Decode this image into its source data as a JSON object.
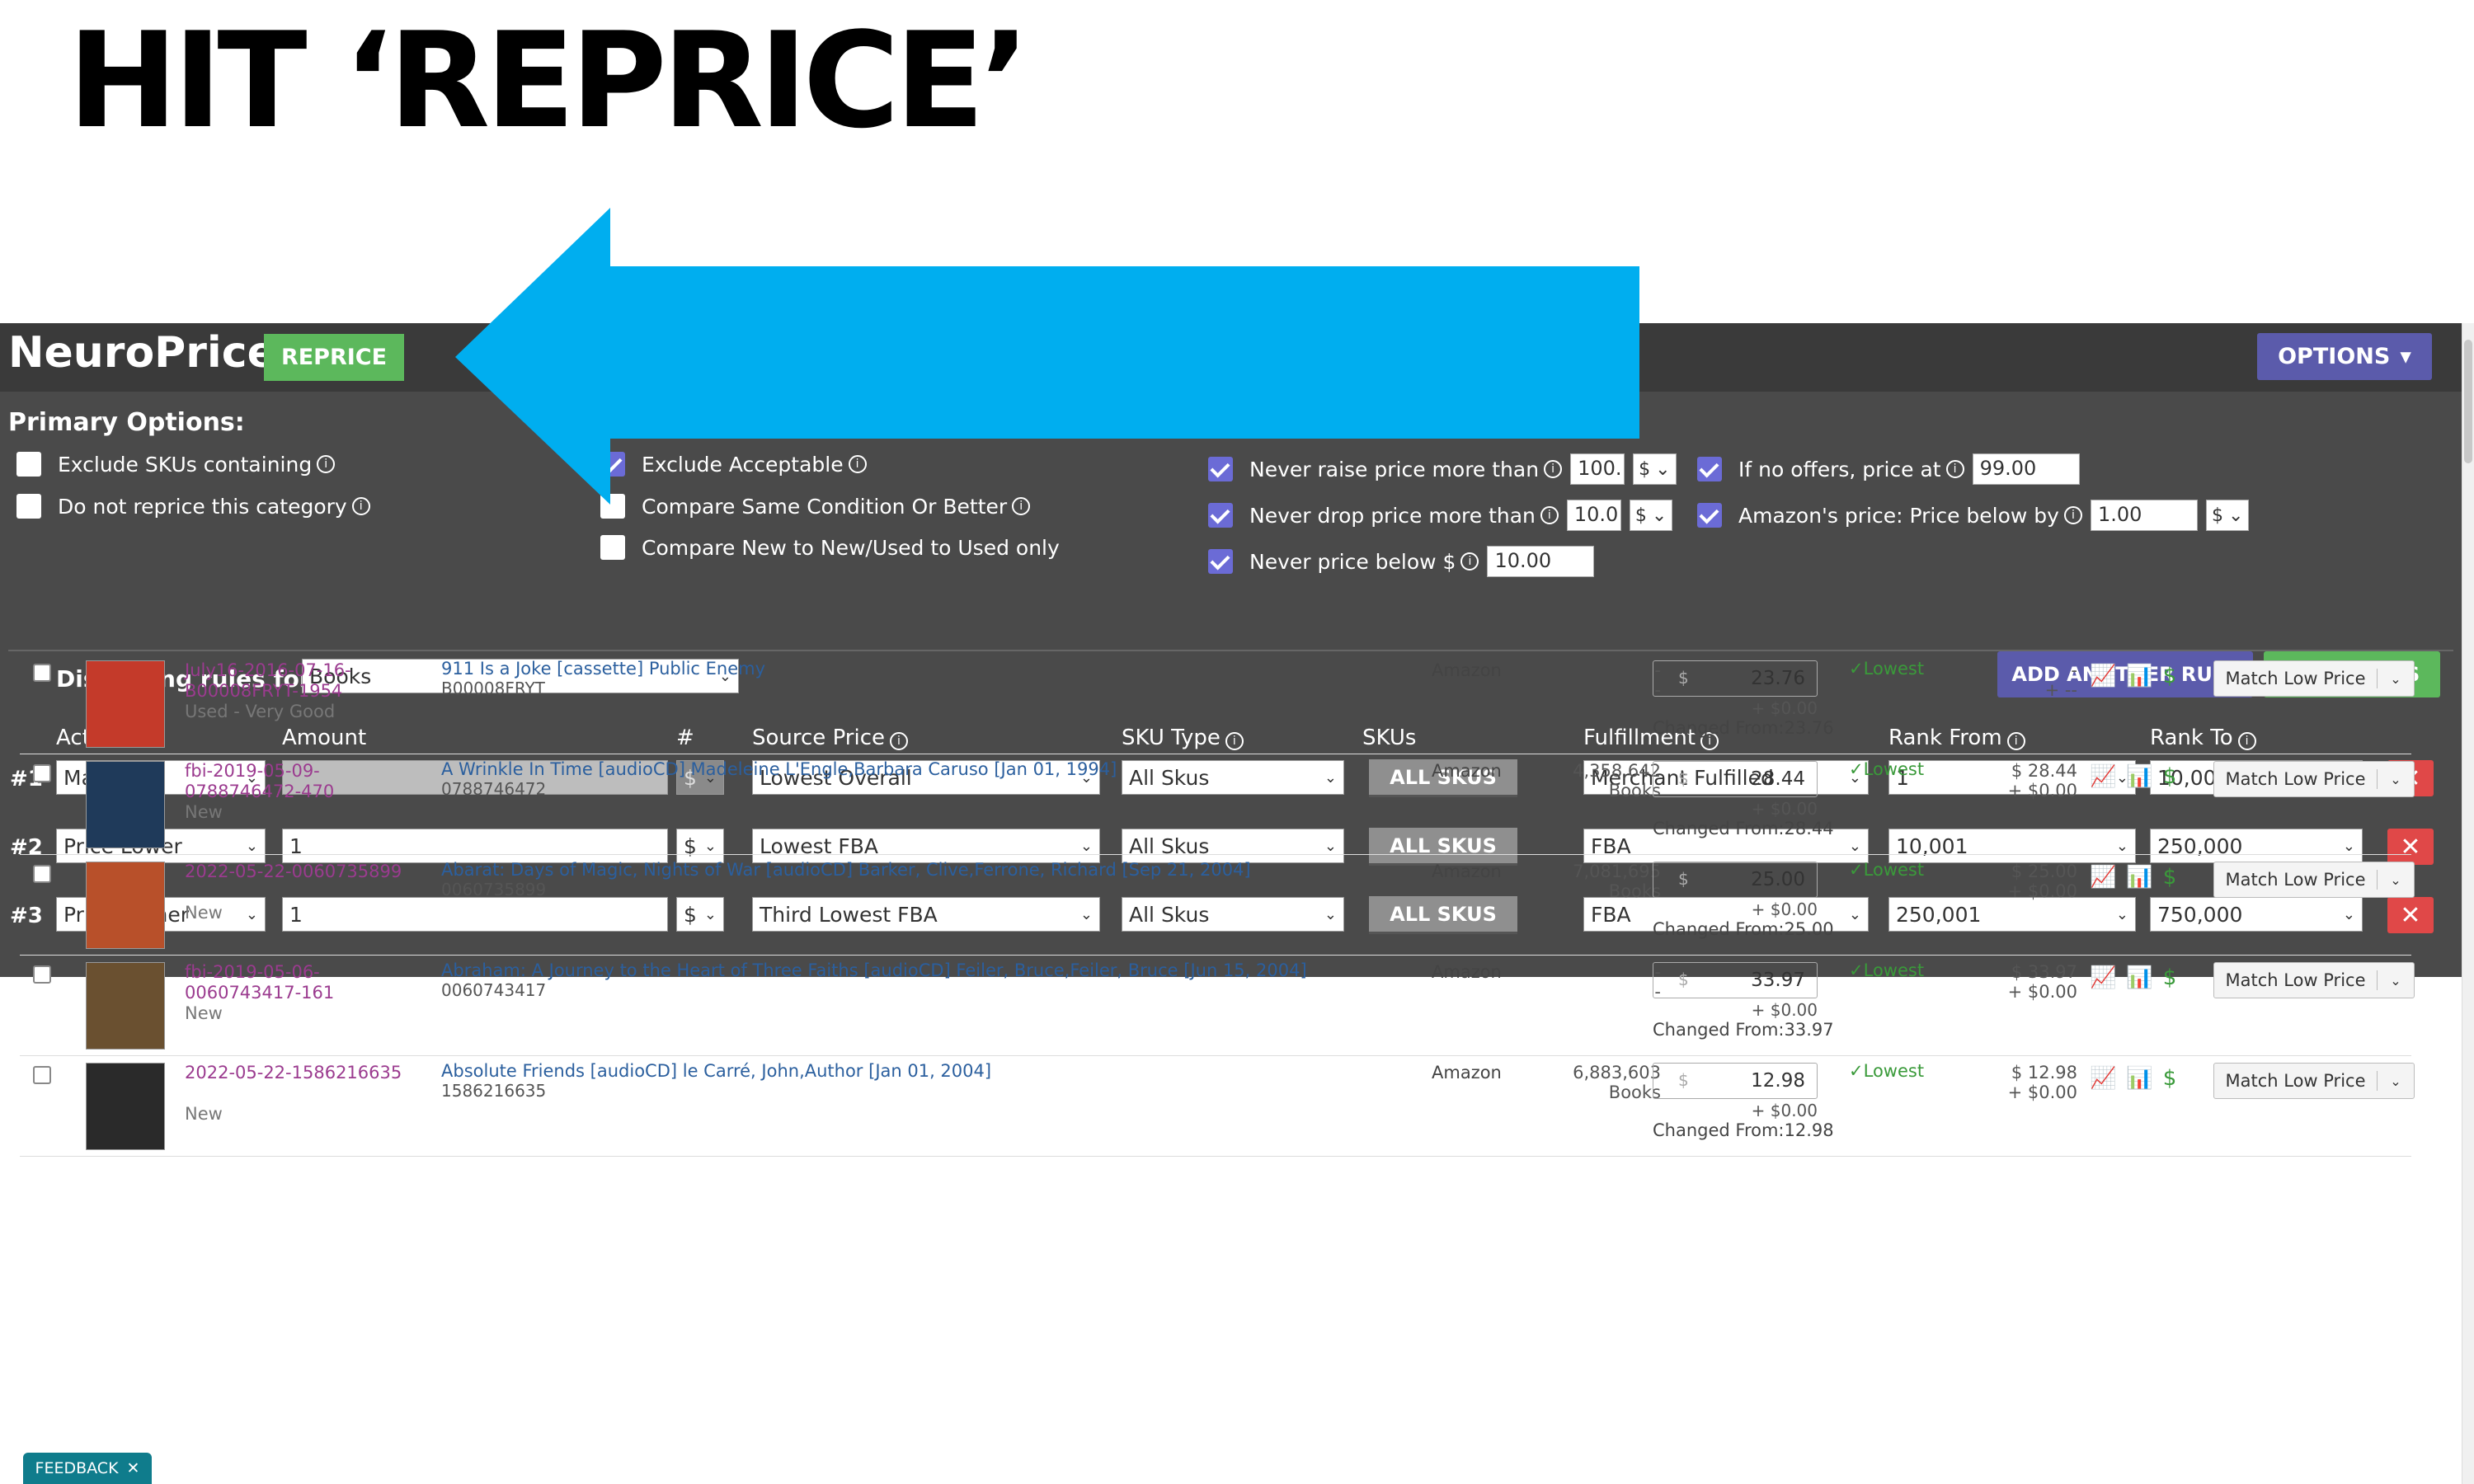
{
  "heading": "HIT ‘REPRICE’",
  "topbar": {
    "logo": "NeuroPrice",
    "reprice_label": "REPRICE",
    "options_label": "OPTIONS",
    "options_caret": "▾"
  },
  "primary": {
    "title": "Primary Options:",
    "col1": [
      {
        "label": "Exclude SKUs containing",
        "checked": false
      },
      {
        "label": "Do not reprice this category",
        "checked": false
      }
    ],
    "col2": [
      {
        "label": "Exclude Acceptable",
        "checked": true
      },
      {
        "label": "Compare Same Condition Or Better",
        "checked": false
      },
      {
        "label": "Compare New to New/Used to Used only",
        "checked": false
      }
    ],
    "col3": [
      {
        "label": "Never raise price more than",
        "value": "100.",
        "unit": "$",
        "checked": true
      },
      {
        "label": "Never drop price more than",
        "value": "10.0",
        "unit": "$",
        "checked": true
      },
      {
        "label": "Never price below $",
        "value": "10.00",
        "checked": true
      }
    ],
    "col4": [
      {
        "label": "If no offers, price at",
        "value": "99.00",
        "checked": true
      },
      {
        "label": "Amazon's price: Price below by",
        "value": "1.00",
        "unit": "$",
        "checked": true
      }
    ]
  },
  "rules": {
    "displaying_label": "Displaying rules for:",
    "category": "Books",
    "add_label": "ADD ANOTHER RULE",
    "save_label": "SAVE RULES",
    "headers": {
      "action": "Action",
      "amount": "Amount",
      "hash": "#",
      "source": "Source Price",
      "skutype": "SKU Type",
      "skus": "SKUs",
      "fulfillment": "Fulfillment",
      "rank_from": "Rank From",
      "rank_to": "Rank To"
    },
    "rows": [
      {
        "num": "#1",
        "action": "Match",
        "amount": "",
        "unit": "$",
        "source": "Lowest Overall",
        "skutype": "All Skus",
        "skus": "ALL SKUS",
        "fulfillment": "Merchant Fulfilled",
        "rank_from": "1",
        "rank_to": "10,000"
      },
      {
        "num": "#2",
        "action": "Price Lower",
        "amount": "1",
        "unit": "$",
        "source": "Lowest FBA",
        "skutype": "All Skus",
        "skus": "ALL SKUS",
        "fulfillment": "FBA",
        "rank_from": "10,001",
        "rank_to": "250,000"
      },
      {
        "num": "#3",
        "action": "Price Higher",
        "amount": "1",
        "unit": "$",
        "source": "Third Lowest FBA",
        "skutype": "All Skus",
        "skus": "ALL SKUS",
        "fulfillment": "FBA",
        "rank_from": "250,001",
        "rank_to": "750,000"
      }
    ]
  },
  "listings": [
    {
      "sku": "July16-2016-07-16-B00008FRYT-1954",
      "condition": "Used - Very Good",
      "title": "911 Is a Joke [cassette] Public Enemy",
      "asin": "B00008FRYT",
      "source": "Amazon",
      "rank": "-",
      "rank_cat": "-",
      "price": "23.76",
      "adj": "+ $0.00",
      "changed": "Changed From:23.76",
      "status": "Lowest",
      "low_price": "-",
      "low_ship": "+ --",
      "action": "Match Low Price",
      "thumb_color": "#c43a2a"
    },
    {
      "sku": "fbi-2019-05-09-0788746472-470",
      "condition": "New",
      "title": "A Wrinkle In Time [audioCD] Madeleine L'Engle,Barbara Caruso [Jan 01, 1994]",
      "asin": "0788746472",
      "source": "Amazon",
      "rank": "4,358,642",
      "rank_cat": "Books",
      "price": "28.44",
      "adj": "+ $0.00",
      "changed": "Changed From:28.44",
      "status": "Lowest",
      "low_price": "$ 28.44",
      "low_ship": "+ $0.00",
      "action": "Match Low Price",
      "thumb_color": "#1f3a5a"
    },
    {
      "sku": "2022-05-22-0060735899",
      "condition": "New",
      "title": "Abarat: Days of Magic, Nights of War [audioCD] Barker, Clive,Ferrone, Richard [Sep 21, 2004]",
      "asin": "0060735899",
      "source": "Amazon",
      "rank": "7,081,695",
      "rank_cat": "Books",
      "price": "25.00",
      "adj": "+ $0.00",
      "changed": "Changed From:25.00",
      "status": "Lowest",
      "low_price": "$ 25.00",
      "low_ship": "+ $0.00",
      "action": "Match Low Price",
      "thumb_color": "#b8502a"
    },
    {
      "sku": "fbi-2019-05-06-0060743417-161",
      "condition": "New",
      "title": "Abraham: A Journey to the Heart of Three Faiths [audioCD] Feiler, Bruce,Feiler, Bruce [Jun 15, 2004]",
      "asin": "0060743417",
      "source": "Amazon",
      "rank": "-",
      "rank_cat": "-",
      "price": "33.97",
      "adj": "+ $0.00",
      "changed": "Changed From:33.97",
      "status": "Lowest",
      "low_price": "$ 33.97",
      "low_ship": "+ $0.00",
      "action": "Match Low Price",
      "thumb_color": "#6a5030"
    },
    {
      "sku": "2022-05-22-1586216635",
      "condition": "New",
      "title": "Absolute Friends [audioCD] le Carré, John,Author [Jan 01, 2004]",
      "asin": "1586216635",
      "source": "Amazon",
      "rank": "6,883,603",
      "rank_cat": "Books",
      "price": "12.98",
      "adj": "+ $0.00",
      "changed": "Changed From:12.98",
      "status": "Lowest",
      "low_price": "$ 12.98",
      "low_ship": "+ $0.00",
      "action": "Match Low Price",
      "thumb_color": "#2a2a2a"
    }
  ],
  "feedback": "FEEDBACK",
  "colors": {
    "arrow": "#00AEEF",
    "topbar": "#3a3a3a",
    "panel": "#4a4a4a",
    "green": "#5cb85c",
    "purple": "#5b5bab"
  }
}
